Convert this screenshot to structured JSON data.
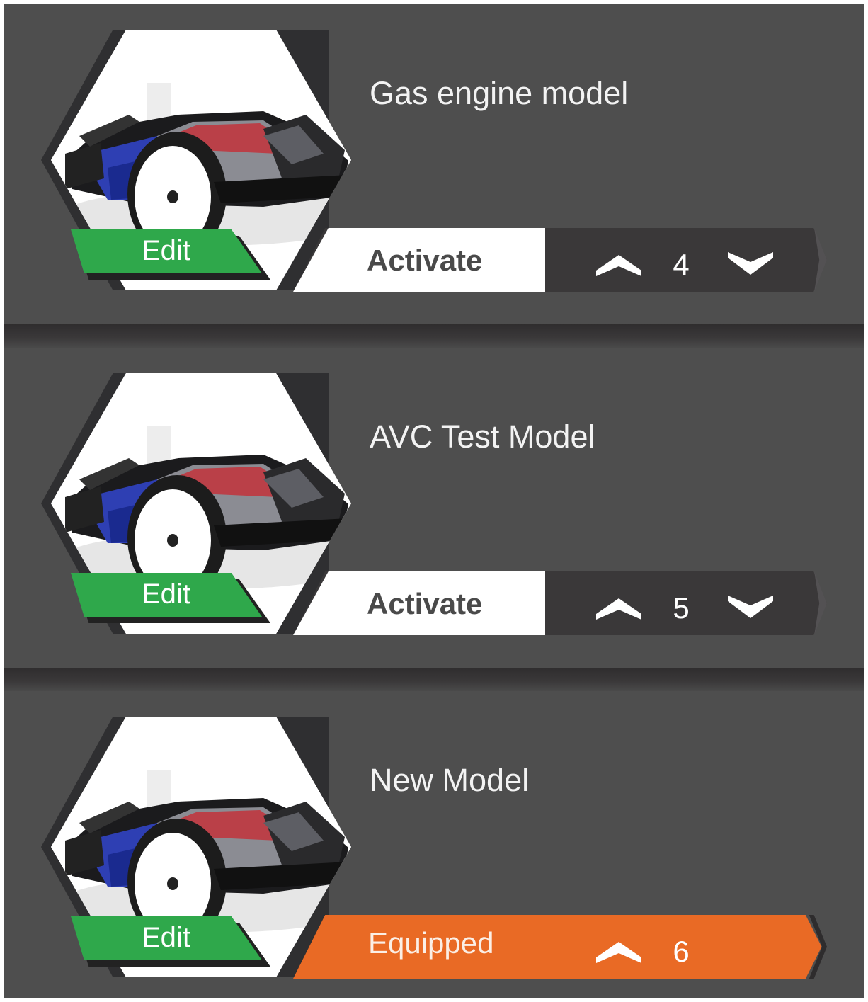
{
  "models": [
    {
      "name": "Gas engine model",
      "edit_label": "Edit",
      "action_label": "Activate",
      "equipped": false,
      "position": "4"
    },
    {
      "name": "AVC Test Model",
      "edit_label": "Edit",
      "action_label": "Activate",
      "equipped": false,
      "position": "5"
    },
    {
      "name": "New Model",
      "edit_label": "Edit",
      "action_label": "Equipped",
      "equipped": true,
      "position": "6"
    }
  ],
  "colors": {
    "panel": "#4e4e4e",
    "edit_green": "#2fa84b",
    "equipped_orange": "#e96a25",
    "activate_bg": "#ffffff",
    "bar_dark": "#3a3839"
  },
  "icons": {
    "move_up": "chevron-up-icon",
    "move_down": "chevron-down-icon",
    "thumbnail": "rc-buggy-image"
  }
}
